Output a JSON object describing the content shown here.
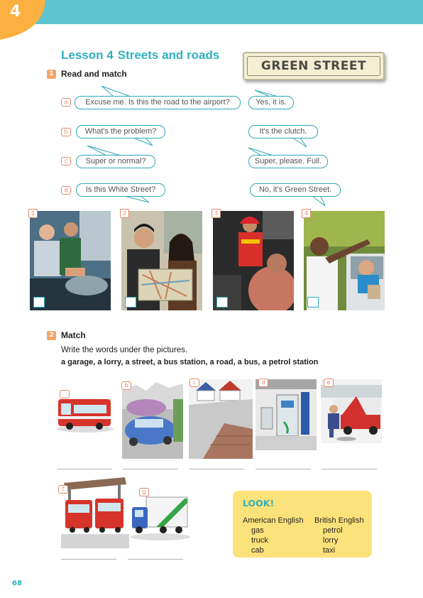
{
  "unit": {
    "number": "4"
  },
  "lesson": {
    "label": "Lesson 4",
    "title": "Streets and roads"
  },
  "sign_text": "GREEN STREET",
  "exercise1": {
    "number": "1",
    "title": "Read and match",
    "rows": [
      {
        "letter": "a",
        "question": "Excuse me. Is this the road to the airport?",
        "answer": "Yes, it is."
      },
      {
        "letter": "b",
        "question": "What's the problem?",
        "answer": "It's the clutch."
      },
      {
        "letter": "c",
        "question": "Super or normal?",
        "answer": "Super, please. Full."
      },
      {
        "letter": "d",
        "question": "Is this White Street?",
        "answer": "No, it's Green Street."
      }
    ],
    "photos": [
      {
        "number": "1",
        "scene": "mechanics looking under car bonnet"
      },
      {
        "number": "2",
        "scene": "couple reading a map"
      },
      {
        "number": "3",
        "scene": "petrol station attendant"
      },
      {
        "number": "4",
        "scene": "man asking driver for directions"
      }
    ]
  },
  "exercise2": {
    "number": "2",
    "title": "Match",
    "instruction": "Write the words under the pictures.",
    "words": [
      "a garage",
      "a lorry",
      "a street",
      "a bus station",
      "a road",
      "a bus",
      "a petrol station"
    ],
    "pictures": [
      {
        "letter": "",
        "subject": "bus"
      },
      {
        "letter": "b",
        "subject": "road"
      },
      {
        "letter": "c",
        "subject": "street"
      },
      {
        "letter": "d",
        "subject": "petrol station"
      },
      {
        "letter": "e",
        "subject": "garage"
      },
      {
        "letter": "f",
        "subject": "bus station"
      },
      {
        "letter": "g",
        "subject": "lorry"
      }
    ]
  },
  "look_box": {
    "title": "LOOK!",
    "col1_header": "American English",
    "col2_header": "British English",
    "american": [
      "gas",
      "truck",
      "cab"
    ],
    "british": [
      "petrol",
      "lorry",
      "taxi"
    ]
  },
  "page_number": "68",
  "colors": {
    "teal": "#5ec4cf",
    "orange": "#f6a46b",
    "yellow_box": "#fce27a",
    "bubble_border": "#2ea9b7"
  }
}
